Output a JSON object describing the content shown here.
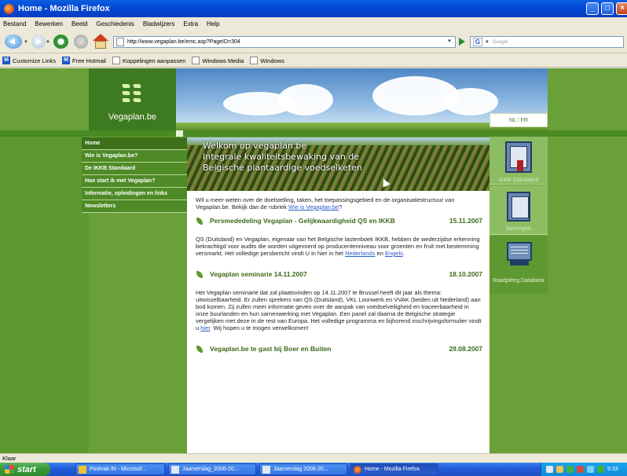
{
  "window": {
    "title": "Home - Mozilla Firefox"
  },
  "menubar": [
    "Bestand",
    "Bewerken",
    "Beeld",
    "Geschiedenis",
    "Bladwijzers",
    "Extra",
    "Help"
  ],
  "navbar": {
    "url": "http://www.vegaplan.be/emc.asp?PageID=304",
    "search_placeholder": "Google",
    "search_engine_letter": "G"
  },
  "bookmarks": [
    {
      "label": "Customize Links",
      "icon": "msn-icon"
    },
    {
      "label": "Free Hotmail",
      "icon": "msn-icon"
    },
    {
      "label": "Koppelingen aanpassen",
      "icon": "page-icon"
    },
    {
      "label": "Windows Media",
      "icon": "page-icon"
    },
    {
      "label": "Windows",
      "icon": "page-icon"
    }
  ],
  "site": {
    "logo_text": "Vegaplan.be",
    "lang": {
      "nl": "NL",
      "sep": " / ",
      "fr": "FR"
    },
    "menu": [
      "Home",
      "Wie is Vegaplan.be?",
      "De IKKB Standaard",
      "Hoe start ik met Vegaplan?",
      "Informatie, opleidingen en links",
      "Newsletters"
    ],
    "banner": {
      "line1": "Welkom op vegaplan.be",
      "line2": "Integrale kwaliteitsbewaking van de",
      "line3": "Belgische plantaardige voedselketen"
    },
    "intro": {
      "text": "Wil u meer weten over de doelstelling, taken, het toepassingsgebied en de organisatiestructuur van Vegaplan.be. Bekijk dan de rubriek ",
      "link": "Wie is Vegaplan.be",
      "end": "?"
    },
    "news": [
      {
        "title": "Persmededeling Vegaplan - Gelijkwaardigheid QS en IKKB",
        "date": "15.11.2007",
        "body": "QS (Duitsland) en Vegaplan, eigenaar van het Belgische lastenboek IKKB, hebben de wederzijdse erkenning bekrachtigd voor audits die worden uitgevoerd op producentenniveau voor groenten en fruit met bestemming versmarkt. Het volledige persbericht vindt U in hier in het ",
        "link1": "Nederlands",
        "mid": " en ",
        "link2": "Engels",
        "end": "."
      },
      {
        "title": "Vegaplan seminarie 14.11.2007",
        "date": "18.10.2007",
        "body": "Het Vegaplan seminarie dat zal plaatsvinden op 14.11.2007 te Brussel heeft dit jaar als thema: uitwisselbaarheid. Er zullen sprekers van QS (Duitsland), VKL Loonwerk en VVAK (beiden uit Nederland) aan bod komen. Zij zullen meer informatie geven over de aanpak van voedselveiligheid en traceerbaarheid in onze buurlanden en hun samenwerking met Vegaplan. Een panel zal daarna de Belgische strategie vergelijken met deze in de rest van Europa. Het volledige programma en bijhorend inschrijvingsformulier vindt u ",
        "link1": "hier",
        "end": ". Wij hopen u te mogen verwelkomen!"
      },
      {
        "title": "Vegaplan.be te gast bij Boer en Buiten",
        "date": "29.08.2007"
      }
    ],
    "right_boxes": [
      {
        "label": "IKKB Standaard",
        "icon": "ikkb-book-icon"
      },
      {
        "label": "Sectorgids",
        "icon": "sectorgids-book-icon"
      },
      {
        "label": "Raadpleeg Databank",
        "icon": "monitor-icon"
      }
    ]
  },
  "status": "Klaar",
  "taskbar": {
    "start": "start",
    "tasks": [
      "Postvak IN - Microsof...",
      "Jaarverslag_2006-20...",
      "Jaarverslag 2006-20...",
      "Home - Mozilla Firefox"
    ],
    "clock": "9:33"
  },
  "colors": {
    "site_green": "#6aa038",
    "dark_green": "#3e7a20",
    "link_blue": "#2a5bc8",
    "xp_blue": "#245edb"
  }
}
